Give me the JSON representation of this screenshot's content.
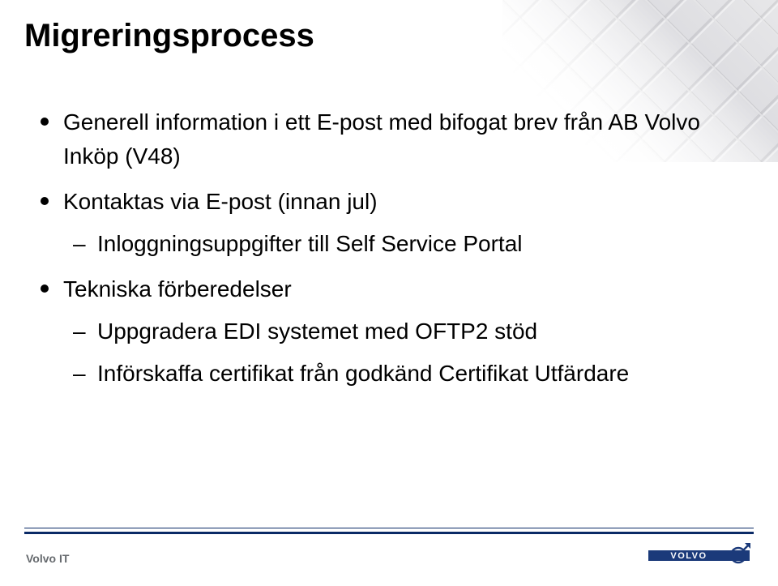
{
  "title": "Migreringsprocess",
  "bullets": {
    "b1": "Generell information i ett E-post med bifogat brev från AB Volvo Inköp (V48)",
    "b2": "Kontaktas via E-post (innan jul)",
    "b2_sub1": "Inloggningsuppgifter till Self Service Portal",
    "b3": "Tekniska förberedelser",
    "b3_sub1": "Uppgradera EDI systemet med OFTP2 stöd",
    "b3_sub2": "Införskaffa certifikat från godkänd Certifikat Utfärdare"
  },
  "footer": {
    "label": "Volvo IT",
    "logo_text": "VOLVO"
  },
  "colors": {
    "rule": "#0a2a66",
    "footer_text": "#666a6e"
  }
}
